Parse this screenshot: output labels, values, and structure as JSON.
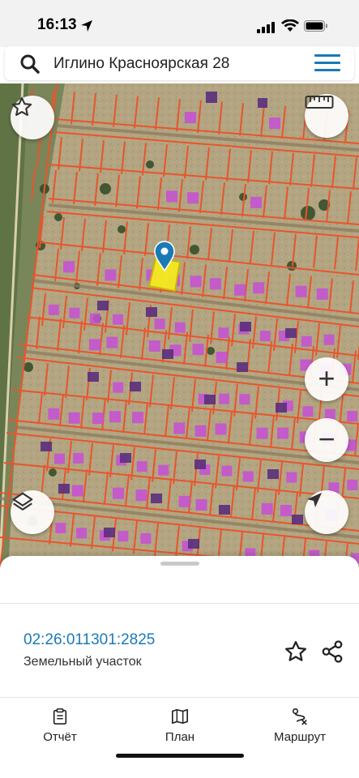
{
  "status": {
    "time": "16:13"
  },
  "search": {
    "query": "Иглино Красноярская 28"
  },
  "map": {
    "parcel_fill": "#f5ea1f",
    "marker_color": "#1a7ab5",
    "boundary_color": "#e8552d",
    "building_color": "#c64fd6"
  },
  "controls": {
    "favorite": "star-icon",
    "ruler": "ruler-icon",
    "zoom_in": "+",
    "zoom_out": "−",
    "layers": "layers-icon",
    "locate": "navigation-arrow-icon"
  },
  "sheet": {
    "cadastral_number": "02:26:011301:2825",
    "object_type": "Земельный участок"
  },
  "tabs": [
    {
      "label": "Отчёт",
      "icon": "report-icon"
    },
    {
      "label": "План",
      "icon": "map-plan-icon"
    },
    {
      "label": "Маршрут",
      "icon": "route-icon"
    }
  ],
  "colors": {
    "accent": "#1a7ab5"
  }
}
